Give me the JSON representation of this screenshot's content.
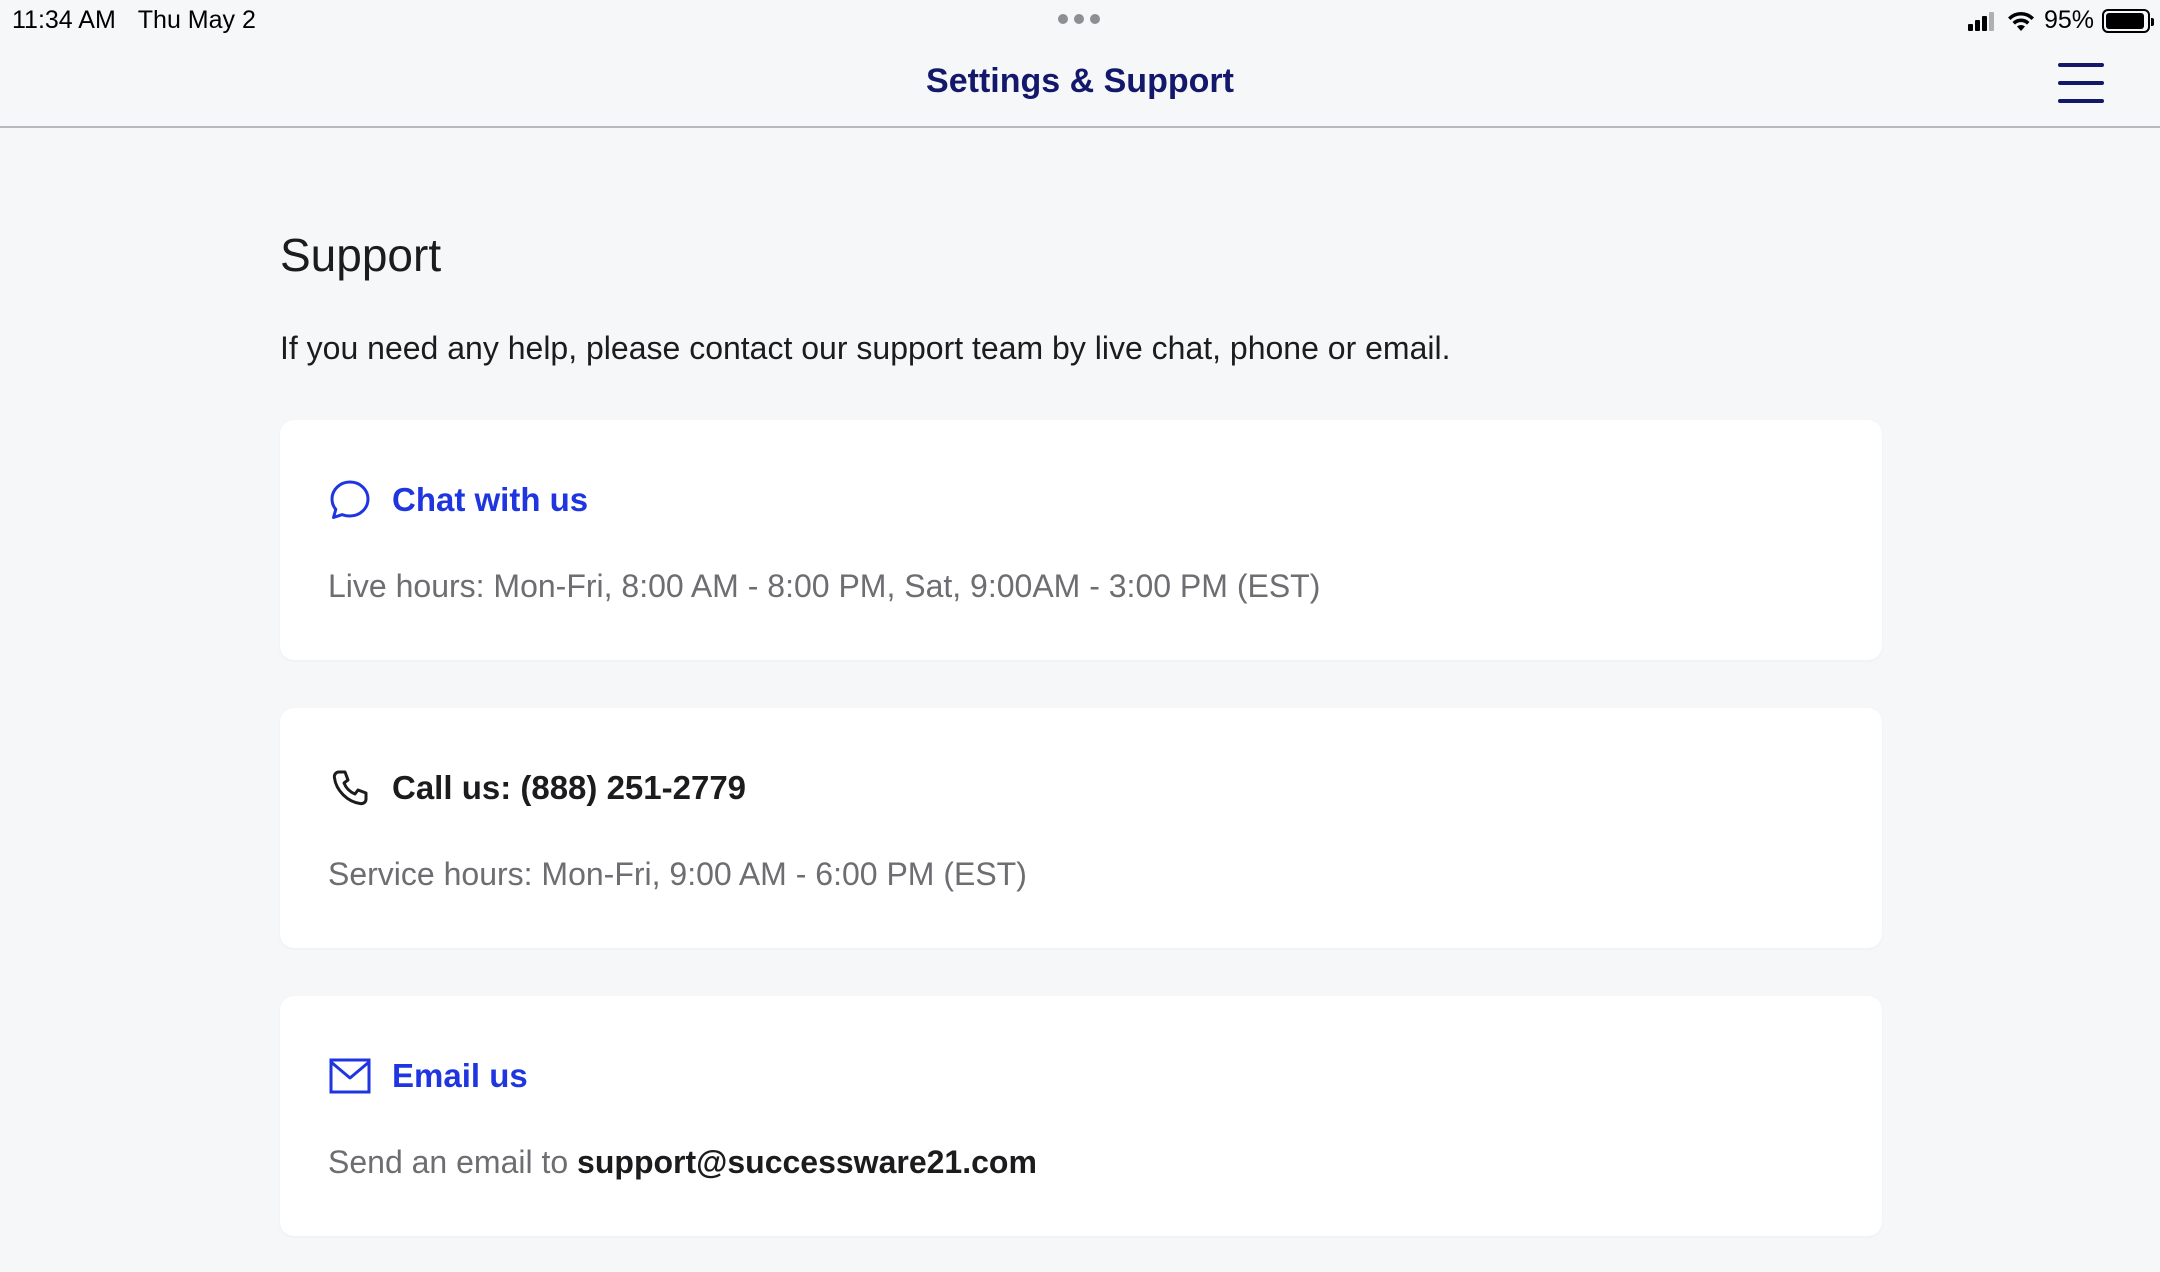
{
  "status_bar": {
    "time": "11:34 AM",
    "date": "Thu May 2",
    "battery_text": "95%",
    "battery_level": 0.95
  },
  "nav": {
    "title": "Settings & Support",
    "menu_icon": "hamburger-menu-icon"
  },
  "support": {
    "heading": "Support",
    "intro": "If you need any help, please contact our support team by live chat, phone or email.",
    "chat": {
      "icon": "chat-bubble-icon",
      "title": "Chat with us",
      "hours": "Live hours: Mon-Fri, 8:00 AM - 8:00 PM, Sat, 9:00AM - 3:00 PM (EST)"
    },
    "call": {
      "icon": "phone-icon",
      "title": "Call us: (888) 251-2779",
      "hours": "Service hours: Mon-Fri, 9:00 AM - 6:00 PM (EST)"
    },
    "email": {
      "icon": "envelope-icon",
      "title": "Email us",
      "prefix": "Send an email to",
      "address": "support@successware21.com"
    }
  },
  "colors": {
    "link_blue": "#1e35e0",
    "nav_navy": "#13186b",
    "background": "#f6f7f9"
  }
}
